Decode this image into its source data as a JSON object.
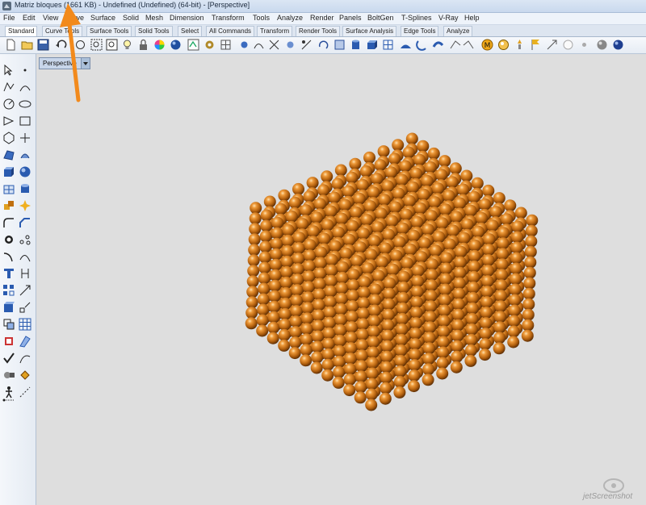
{
  "window": {
    "title": "Matriz bloques (1661 KB) - Undefined (Undefined) (64-bit) - [Perspective]"
  },
  "menu": {
    "items": [
      "File",
      "Edit",
      "View",
      "Curve",
      "Surface",
      "Solid",
      "Mesh",
      "Dimension",
      "Transform",
      "Tools",
      "Analyze",
      "Render",
      "Panels",
      "BoltGen",
      "T-Splines",
      "V-Ray",
      "Help"
    ]
  },
  "tabs": {
    "items": [
      "Standard",
      "Curve Tools",
      "Surface Tools",
      "Solid Tools",
      "Select",
      "All Commands",
      "Transform",
      "Render Tools",
      "Surface Analysis",
      "Edge Tools",
      "Analyze"
    ],
    "active": "Standard"
  },
  "viewport": {
    "label": "Perspective"
  },
  "scene": {
    "sphere_color": "#cc7a1e",
    "background": "#dedede"
  },
  "watermark": {
    "text": "jetScreenshot"
  },
  "annotation": {
    "arrow_color": "#f28a1c"
  }
}
